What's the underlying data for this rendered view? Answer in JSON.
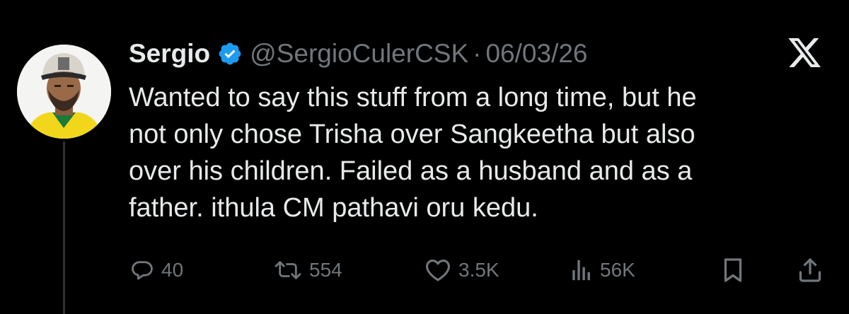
{
  "tweet": {
    "display_name": "Sergio",
    "handle": "@SergioCulerCSK",
    "separator": "·",
    "date": "06/03/26",
    "verified": true,
    "text_lines": [
      "Wanted to say this stuff from a long time, but he",
      "not only chose Trisha over Sangkeetha but also",
      "over his children. Failed as a husband and as a",
      "father. ithula CM pathavi oru kedu."
    ]
  },
  "actions": {
    "replies": "40",
    "reposts": "554",
    "likes": "3.5K",
    "views": "56K"
  },
  "icons": {
    "verified": "verified-badge-icon",
    "brand": "x-logo-icon",
    "reply": "reply-icon",
    "repost": "repost-icon",
    "like": "heart-icon",
    "views": "views-chart-icon",
    "bookmark": "bookmark-icon",
    "share": "share-icon"
  },
  "colors": {
    "background": "#000000",
    "text": "#e7e9ea",
    "muted": "#71767b",
    "verified": "#1d9bf0"
  }
}
